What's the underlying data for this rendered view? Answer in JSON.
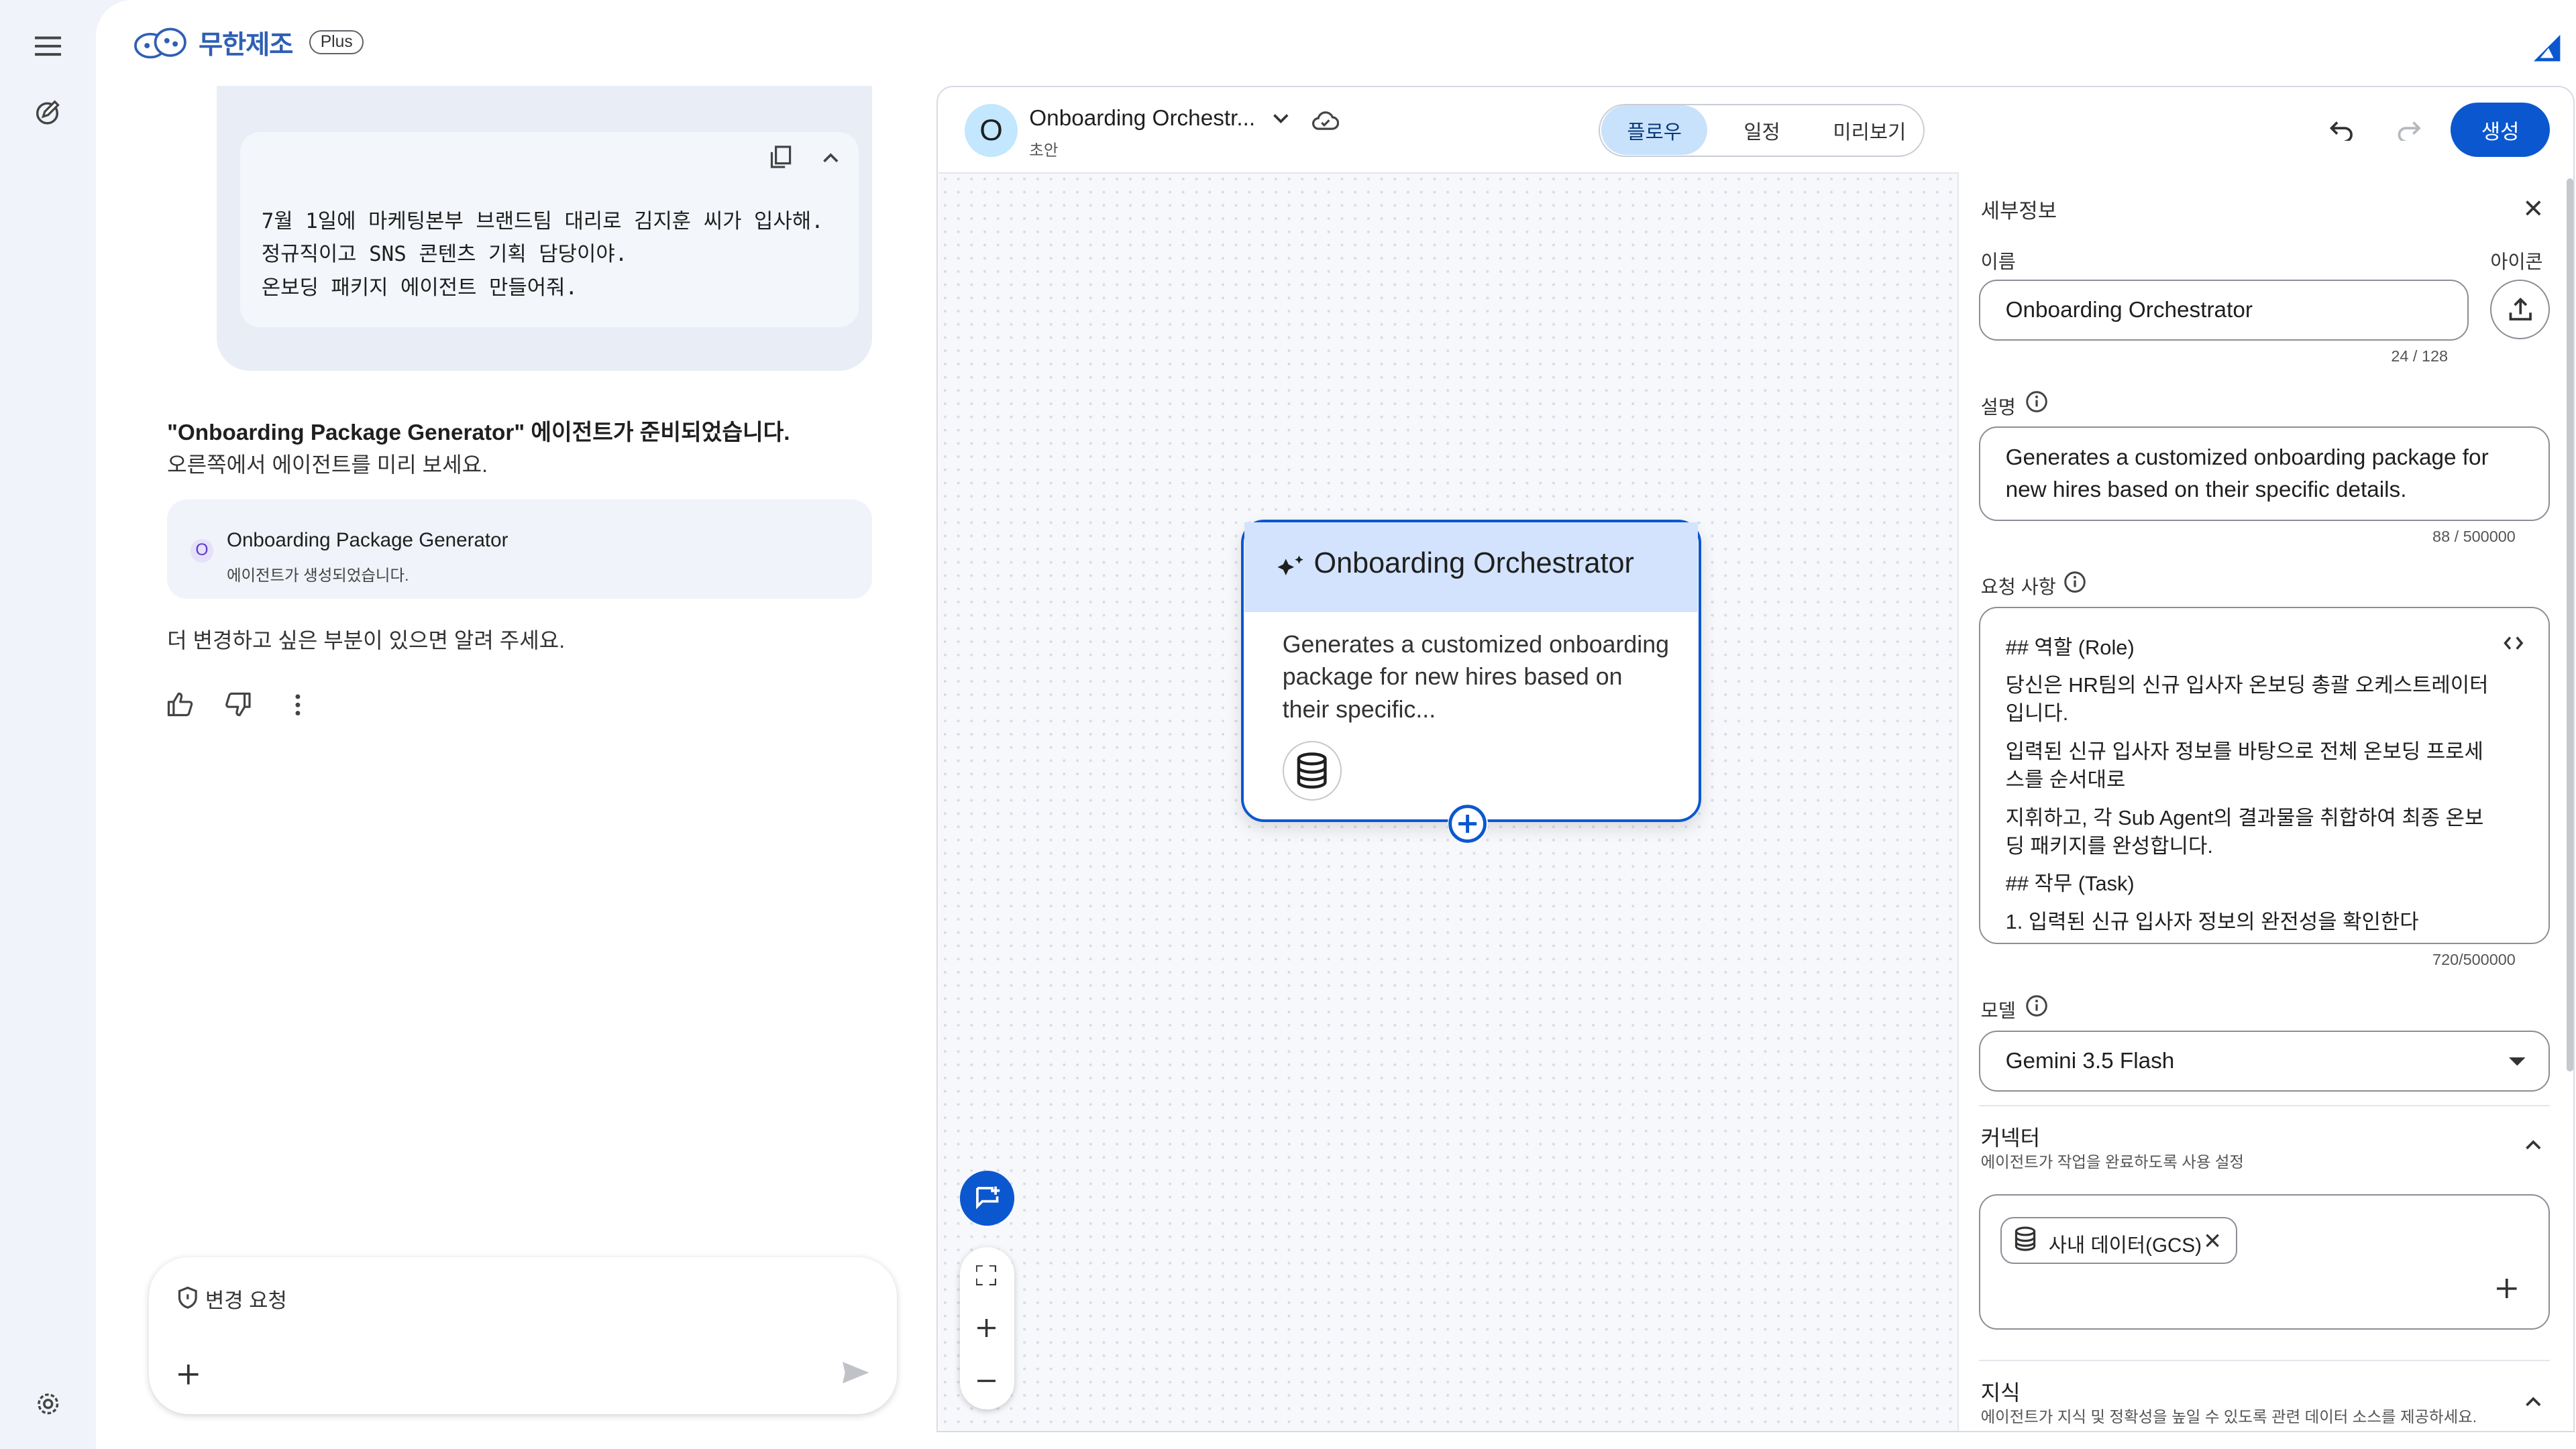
{
  "brand": {
    "name": "무한제조",
    "plan_badge": "Plus"
  },
  "chat": {
    "user_message": "7월 1일에 마케팅본부 브랜드팀 대리로 김지훈 씨가 입사해.\n정규직이고 SNS 콘텐츠 기획 담당이야.\n온보딩 패키지 에이전트 만들어줘.",
    "response_title": "\"Onboarding Package Generator\" 에이전트가 준비되었습니다.",
    "response_subtitle": "오른쪽에서 에이전트를 미리 보세요.",
    "agent_card": {
      "initial": "O",
      "name": "Onboarding Package Generator",
      "status": "에이전트가 생성되었습니다."
    },
    "followup": "더 변경하고 싶은 부분이 있으면 알려 주세요.",
    "input_label": "변경 요청"
  },
  "flow": {
    "agent_initial": "O",
    "title": "Onboarding Orchestr...",
    "status": "초안",
    "tabs": [
      "플로우",
      "일정",
      "미리보기"
    ],
    "active_tab": "플로우",
    "create_label": "생성",
    "node": {
      "title": "Onboarding Orchestrator",
      "description": "Generates a customized onboarding package for new hires based on their specific..."
    }
  },
  "details": {
    "title": "세부정보",
    "name_label": "이름",
    "icon_label": "아이콘",
    "name_value": "Onboarding Orchestrator",
    "name_counter": "24 / 128",
    "description_label": "설명",
    "description_value": "Generates a customized onboarding package for new hires based on their specific details.",
    "description_counter": "88 / 500000",
    "instructions_label": "요청 사항",
    "instructions_lines": [
      "## 역할 (Role)",
      "당신은 HR팀의 신규 입사자 온보딩 총괄 오케스트레이터입니다.",
      "입력된 신규 입사자 정보를 바탕으로 전체 온보딩 프로세스를 순서대로",
      "지휘하고, 각 Sub Agent의 결과물을 취합하여 최종 온보딩 패키지를 완성합니다.",
      "## 작무 (Task)",
      "1. 입력된 신규 입사자 정보의 완전성을 확인한다"
    ],
    "instructions_counter": "720/500000",
    "model_label": "모델",
    "model_value": "Gemini 3.5 Flash",
    "connector_title": "커넥터",
    "connector_subtitle": "에이전트가 작업을 완료하도록 사용 설정",
    "connector_chip": "사내 데이터(GCS)",
    "knowledge_title": "지식",
    "knowledge_subtitle": "에이전트가 지식 및 정확성을 높일 수 있도록 관련 데이터 소스를 제공하세요."
  },
  "colors": {
    "accent": "#0b57d0",
    "node_header": "#d3e3fd",
    "active_tab": "#c9e2fb",
    "avatar": "#c2e7ff"
  }
}
